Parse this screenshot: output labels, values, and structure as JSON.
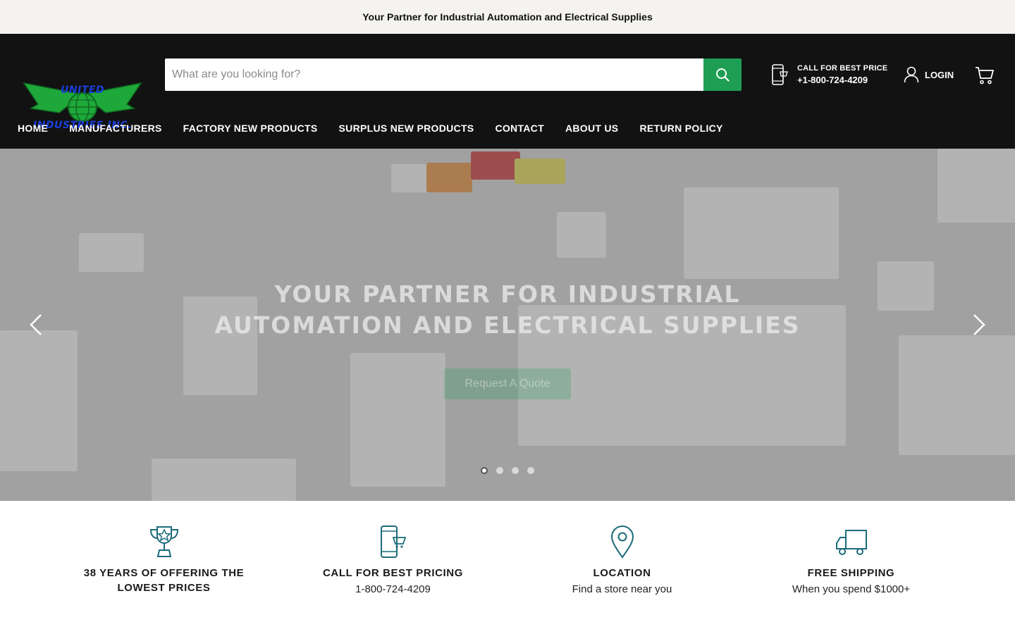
{
  "announcement": "Your Partner for Industrial Automation and Electrical Supplies",
  "logo": {
    "line1": "UNITED",
    "line2": "INDUSTRIES INC."
  },
  "search": {
    "placeholder": "What are you looking for?"
  },
  "call": {
    "label": "CALL FOR BEST PRICE",
    "phone": "+1-800-724-4209"
  },
  "account": {
    "login_label": "LOGIN"
  },
  "nav": [
    "HOME",
    "MANUFACTURERS",
    "FACTORY NEW PRODUCTS",
    "SURPLUS NEW PRODUCTS",
    "CONTACT",
    "ABOUT US",
    "RETURN POLICY"
  ],
  "hero": {
    "title_line1": "YOUR PARTNER FOR INDUSTRIAL",
    "title_line2": "AUTOMATION AND ELECTRICAL SUPPLIES",
    "button_label": "Request A Quote",
    "slide_count": 4,
    "active_slide": 1
  },
  "features": [
    {
      "icon": "trophy-icon",
      "title": "38 YEARS OF OFFERING THE LOWEST PRICES",
      "subtitle": ""
    },
    {
      "icon": "phone-cart-icon",
      "title": "CALL FOR BEST PRICING",
      "subtitle": "1-800-724-4209"
    },
    {
      "icon": "location-pin-icon",
      "title": "LOCATION",
      "subtitle": "Find a store near you"
    },
    {
      "icon": "truck-icon",
      "title": "FREE SHIPPING",
      "subtitle": "When you spend $1000+"
    }
  ],
  "colors": {
    "accent": "#1e9e52",
    "header_bg": "#121212",
    "icon_teal": "#1b6b7a"
  }
}
